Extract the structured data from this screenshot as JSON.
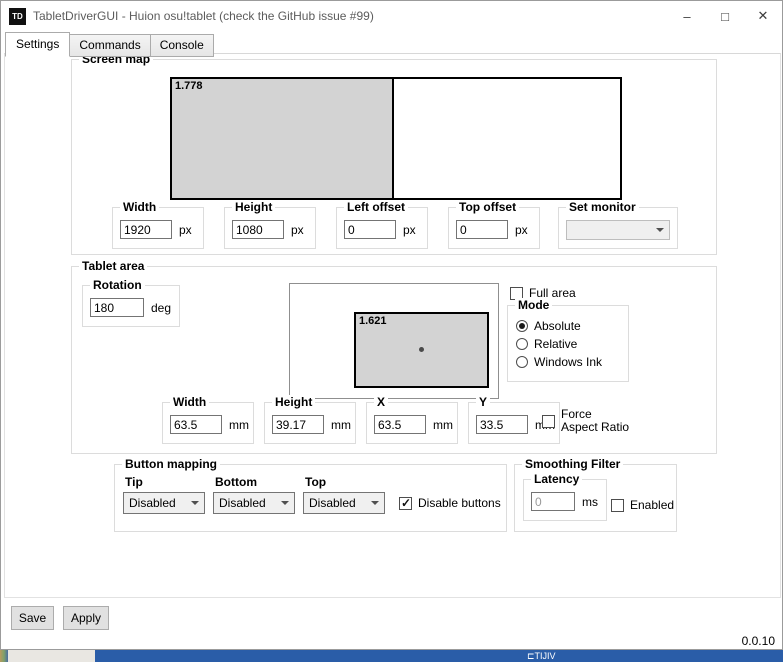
{
  "window": {
    "title": "TabletDriverGUI - Huion osu!tablet (check the GitHub issue #99)",
    "icon_text": "TD",
    "controls": {
      "minimize": "–",
      "maximize": "□",
      "close": "✕"
    }
  },
  "tabs": [
    {
      "label": "Settings",
      "active": true
    },
    {
      "label": "Commands",
      "active": false
    },
    {
      "label": "Console",
      "active": false
    }
  ],
  "screen_map": {
    "title": "Screen map",
    "monitor1_ratio": "1.778",
    "fields": {
      "width": {
        "label": "Width",
        "value": "1920",
        "unit": "px"
      },
      "height": {
        "label": "Height",
        "value": "1080",
        "unit": "px"
      },
      "left_offset": {
        "label": "Left offset",
        "value": "0",
        "unit": "px"
      },
      "top_offset": {
        "label": "Top offset",
        "value": "0",
        "unit": "px"
      },
      "set_monitor": {
        "label": "Set monitor",
        "value": ""
      }
    }
  },
  "tablet_area": {
    "title": "Tablet area",
    "rotation": {
      "label": "Rotation",
      "value": "180",
      "unit": "deg"
    },
    "area_ratio": "1.621",
    "full_area": {
      "label": "Full area",
      "checked": false
    },
    "mode": {
      "title": "Mode",
      "options": [
        {
          "label": "Absolute",
          "selected": true
        },
        {
          "label": "Relative",
          "selected": false
        },
        {
          "label": "Windows Ink",
          "selected": false
        }
      ]
    },
    "fields": {
      "width": {
        "label": "Width",
        "value": "63.5",
        "unit": "mm"
      },
      "height": {
        "label": "Height",
        "value": "39.17",
        "unit": "mm"
      },
      "x": {
        "label": "X",
        "value": "63.5",
        "unit": "mm"
      },
      "y": {
        "label": "Y",
        "value": "33.5",
        "unit": "mm"
      }
    },
    "force_aspect": {
      "label": "Force Aspect Ratio",
      "checked": false
    }
  },
  "button_mapping": {
    "title": "Button mapping",
    "tip": {
      "label": "Tip",
      "value": "Disabled"
    },
    "bottom": {
      "label": "Bottom",
      "value": "Disabled"
    },
    "top": {
      "label": "Top",
      "value": "Disabled"
    },
    "disable_buttons": {
      "label": "Disable buttons",
      "checked": true
    }
  },
  "smoothing": {
    "title": "Smoothing Filter",
    "latency": {
      "label": "Latency",
      "value": "0",
      "unit": "ms",
      "disabled": true
    },
    "enabled": {
      "label": "Enabled",
      "checked": false
    }
  },
  "footer": {
    "save": "Save",
    "apply": "Apply",
    "version": "0.0.10"
  },
  "taskbar": {
    "partial_text": "⊏TIJIV"
  },
  "colors": {
    "monitor_fill": "#d3d3d3",
    "taskbar_blue": "#2a5da8",
    "icon_bg": "#101010"
  }
}
